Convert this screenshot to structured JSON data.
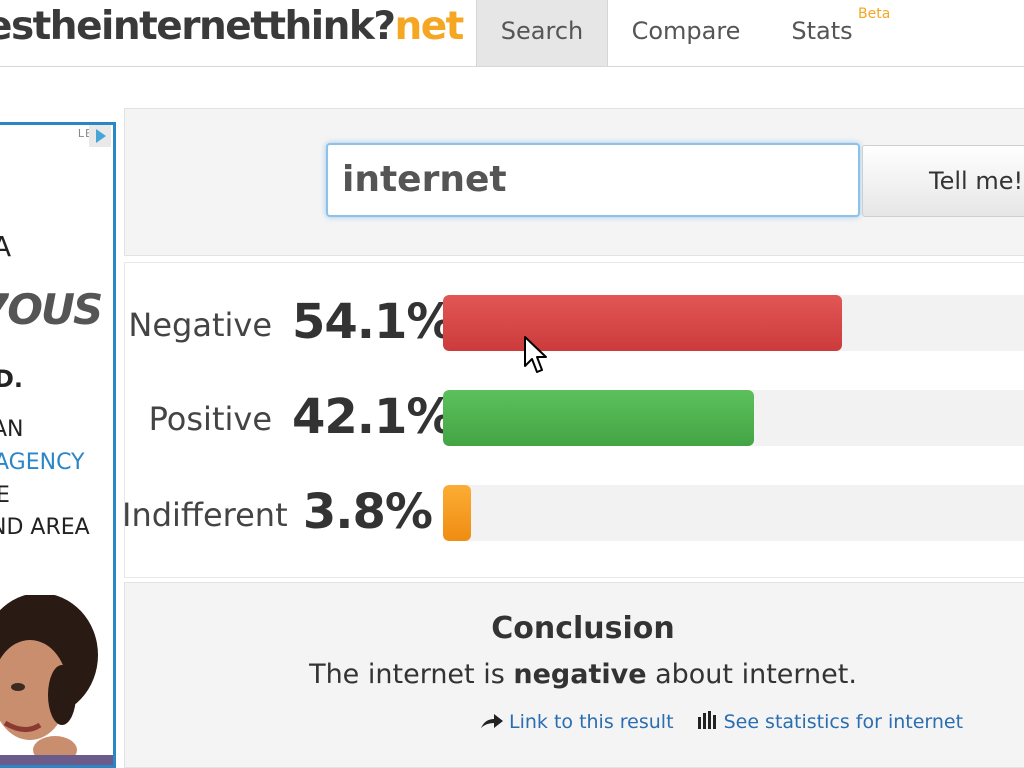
{
  "brand": {
    "name_main": "estheinternetthink?",
    "name_tld": "net"
  },
  "nav": {
    "tabs": [
      {
        "label": "Search"
      },
      {
        "label": "Compare"
      },
      {
        "label": "Stats"
      }
    ],
    "stats_badge": "Beta",
    "active_tab": "Search"
  },
  "ad": {
    "choices_label": "LEGA",
    "lines": [
      "A",
      "7OUS",
      "D.",
      "AN",
      "AGENCY",
      "E",
      "ND AREA"
    ],
    "accent_color": "#2b86c8"
  },
  "search": {
    "query": "internet",
    "button_label": "Tell me!"
  },
  "results": [
    {
      "label": "Negative",
      "percent_text": "54.1%",
      "value": 54.1,
      "color": "#d94646"
    },
    {
      "label": "Positive",
      "percent_text": "42.1%",
      "value": 42.1,
      "color": "#4caf50"
    },
    {
      "label": "Indifferent",
      "percent_text": "3.8%",
      "value": 3.8,
      "color": "#f7a01e"
    }
  ],
  "conclusion": {
    "title": "Conclusion",
    "text_before": "The internet is ",
    "text_bold": "negative",
    "text_after": " about internet.",
    "link_result": "Link to this result",
    "link_stats": "See statistics for internet"
  }
}
